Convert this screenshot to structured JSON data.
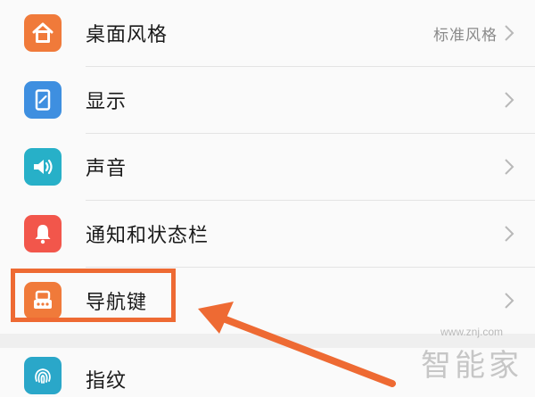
{
  "settings": {
    "items": [
      {
        "label": "桌面风格",
        "value": "标准风格",
        "icon": "home-icon",
        "color": "#f07a3a"
      },
      {
        "label": "显示",
        "value": "",
        "icon": "display-icon",
        "color": "#3e8fe0"
      },
      {
        "label": "声音",
        "value": "",
        "icon": "sound-icon",
        "color": "#27b0c8"
      },
      {
        "label": "通知和状态栏",
        "value": "",
        "icon": "bell-icon",
        "color": "#f2564b"
      },
      {
        "label": "导航键",
        "value": "",
        "icon": "navigation-key-icon",
        "color": "#f07a3a"
      },
      {
        "label": "指纹",
        "value": "",
        "icon": "fingerprint-icon",
        "color": "#2aa7c9"
      }
    ]
  },
  "annotation": {
    "highlight_color": "#ee6a33",
    "arrow_color": "#ee6a33"
  },
  "watermark": {
    "text": "智能家",
    "url": "www.znj.com"
  }
}
